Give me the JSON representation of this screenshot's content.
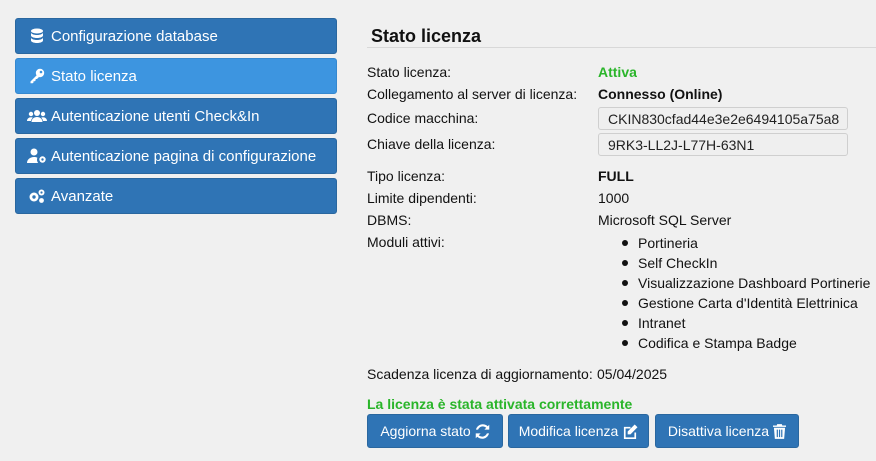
{
  "sidebar": {
    "items": [
      {
        "label": "Configurazione database",
        "icon": "database-icon"
      },
      {
        "label": "Stato licenza",
        "icon": "key-icon",
        "active": true
      },
      {
        "label": "Autenticazione utenti Check&In",
        "icon": "users-icon"
      },
      {
        "label": "Autenticazione pagina di configurazione",
        "icon": "user-cog-icon"
      },
      {
        "label": "Avanzate",
        "icon": "cogs-icon"
      }
    ]
  },
  "main": {
    "title": "Stato licenza",
    "rows": {
      "status": {
        "label": "Stato licenza:",
        "value": "Attiva"
      },
      "server": {
        "label": "Collegamento al server di licenza:",
        "value": "Connesso (Online)"
      },
      "machine_code": {
        "label": "Codice macchina:",
        "value": "CKIN830cfad44e3e2e6494105a75a8"
      },
      "license_key": {
        "label": "Chiave della licenza:",
        "value": "9RK3-LL2J-L77H-63N1"
      },
      "license_type": {
        "label": "Tipo licenza:",
        "value": "FULL"
      },
      "employee_limit": {
        "label": "Limite dipendenti:",
        "value": "1000"
      },
      "dbms": {
        "label": "DBMS:",
        "value": "Microsoft SQL Server"
      },
      "modules": {
        "label": "Moduli attivi:",
        "items": [
          "Portineria",
          "Self CheckIn",
          "Visualizzazione Dashboard Portinerie",
          "Gestione Carta d'Identità Elettrinica",
          "Intranet",
          "Codifica e Stampa Badge"
        ]
      },
      "update_expiry": {
        "label": "Scadenza licenza di aggiornamento:",
        "value": "05/04/2025"
      }
    },
    "success_message": "La licenza è stata attivata correttamente",
    "buttons": {
      "refresh": "Aggiorna stato",
      "edit": "Modifica licenza",
      "deactivate": "Disattiva licenza"
    }
  },
  "colors": {
    "accent": "#2f74b5",
    "active": "#3d95e0",
    "success": "#2ab52a"
  }
}
